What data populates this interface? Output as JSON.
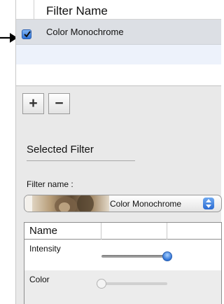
{
  "filters_table": {
    "column_header": "Filter Name",
    "rows": [
      {
        "label": "Color Monochrome",
        "checked": true
      }
    ]
  },
  "toolbar": {
    "add_label": "+",
    "remove_label": "−"
  },
  "selected_filter": {
    "section_title": "Selected Filter",
    "filter_name_label": "Filter name :",
    "filter_name_value": "Color Monochrome"
  },
  "parameters": {
    "column_header": "Name",
    "rows": [
      {
        "label": "Intensity",
        "value": 1.0,
        "enabled": true
      },
      {
        "label": "Color",
        "value": 0.0,
        "enabled": false
      }
    ]
  },
  "colors": {
    "accent": "#2f74d8",
    "selected_row": "#dcdfe4",
    "panel_background": "#e9e9e9"
  }
}
